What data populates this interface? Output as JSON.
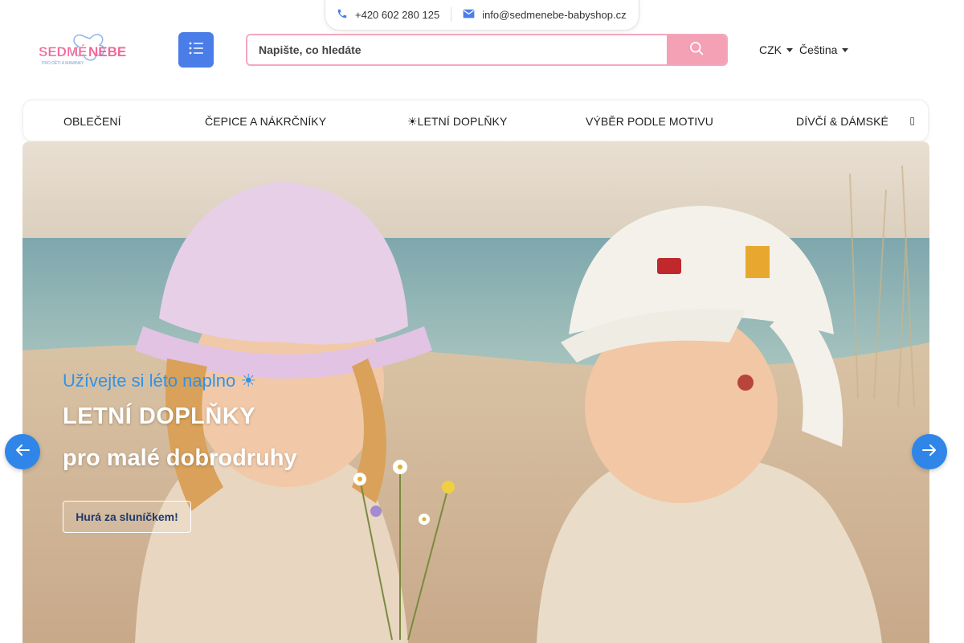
{
  "contact": {
    "phone": "+420 602 280 125",
    "email": "info@sedmenebe-babyshop.cz"
  },
  "logo": {
    "text_main": "SEDMÉ NEBE",
    "tagline": "PRO DĚTI A MAMINKY"
  },
  "search": {
    "placeholder": "Napište, co hledáte"
  },
  "currency": {
    "selected": "CZK"
  },
  "language": {
    "selected": "Čeština"
  },
  "nav": {
    "items": [
      {
        "label": "OBLEČENÍ"
      },
      {
        "label": "ČEPICE A NÁKRČNÍKY"
      },
      {
        "label": "☀LETNÍ DOPLŇKY"
      },
      {
        "label": "VÝBĚR PODLE MOTIVU"
      },
      {
        "label": "DÍVČÍ & DÁMSKÉ"
      }
    ]
  },
  "hero": {
    "subtitle": "Užívejte si léto naplno ☀",
    "title_line1": "LETNÍ DOPLŇKY",
    "title_line2": "pro malé dobrodruhy",
    "cta": "Hurá za sluníčkem!"
  },
  "colors": {
    "menu_button": "#4a7de8",
    "search_button": "#f4a0b5",
    "arrows": "#2f86e8",
    "subtitle": "#2f93e8"
  },
  "icons": {
    "phone": "phone-icon",
    "email": "mail-icon",
    "menu": "list-icon",
    "search": "search-icon",
    "prev": "arrow-left-icon",
    "next": "arrow-right-icon"
  }
}
